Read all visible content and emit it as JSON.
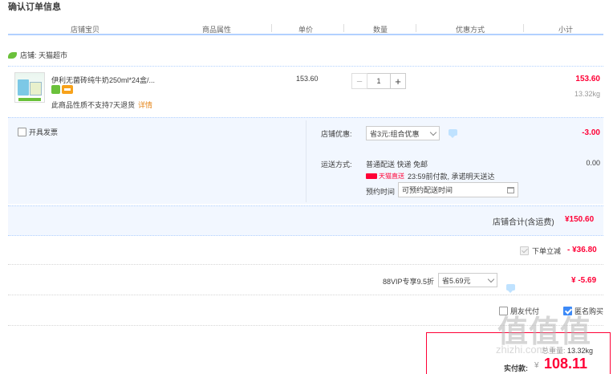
{
  "page": {
    "title": "确认订单信息"
  },
  "columns": [
    "店铺宝贝",
    "商品属性",
    "单价",
    "数量",
    "优惠方式",
    "小计"
  ],
  "store": {
    "label": "店铺: 天猫超市"
  },
  "item": {
    "name": "伊利无菌砖纯牛奶250ml*24盒/...",
    "notice": "此商品性质不支持7天退货",
    "notice_link": "详情",
    "unit_price": "153.60",
    "quantity": "1",
    "minus": "−",
    "plus": "+",
    "subtotal": "153.60",
    "weight": "13.32kg"
  },
  "invoice": {
    "label": "开具发票"
  },
  "shop_discount": {
    "label": "店铺优惠:",
    "selected": "省3元:组合优惠",
    "value": "-3.00"
  },
  "shipping": {
    "label": "运送方式:",
    "method": "普通配送 快递 免邮",
    "brand": "天猫直送",
    "promise": "23:59前付款, 承诺明天送达",
    "time_label": "预约时间",
    "time_value": "可预约配送时间",
    "fee": "0.00"
  },
  "store_total": {
    "label": "店铺合计(含运费)",
    "value": "¥150.60"
  },
  "instant_discount": {
    "label": "下单立减",
    "value": "- ¥36.80"
  },
  "vip": {
    "label": "88VIP专享9.5折",
    "selected": "省5.69元",
    "value": "¥ -5.69"
  },
  "options": {
    "friend_pay": "朋友代付",
    "anonymous": "匿名购买"
  },
  "summary": {
    "weight_label": "总重量:",
    "weight_value": "13.32kg",
    "pay_label": "实付款:",
    "currency": "¥",
    "pay_value": "108.11"
  },
  "watermark": {
    "main": "值值值",
    "sub": "zhizhi.com"
  },
  "colors": {
    "accent_red": "#ff0036",
    "header_blue": "#b2d1ff",
    "panel_bg": "#f2f7ff",
    "checkbox_blue": "#3d8af7"
  }
}
